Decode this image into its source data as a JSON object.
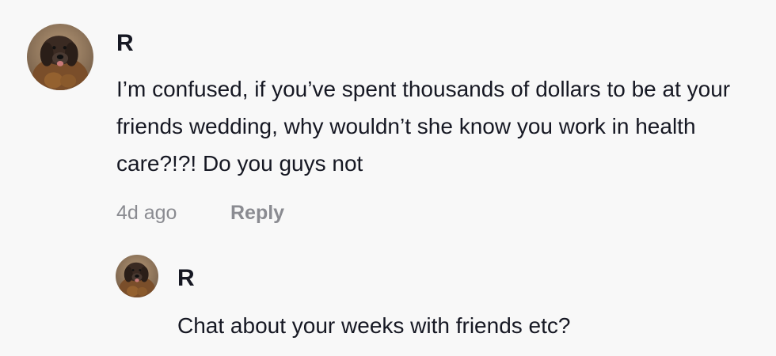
{
  "comments": [
    {
      "username": "R",
      "text": "I’m confused, if you’ve spent thousands of dollars to be at your friends wedding, why wouldn’t she know you work in health care?!?! Do you guys not",
      "time": "4d ago",
      "reply_label": "Reply",
      "avatar_icon": "dog-photo-avatar"
    },
    {
      "username": "R",
      "text": "Chat about your weeks with friends etc?",
      "avatar_icon": "dog-photo-avatar"
    }
  ],
  "colors": {
    "background": "#f8f8f8",
    "text": "#161823",
    "secondary_text": "#8a8b91"
  }
}
